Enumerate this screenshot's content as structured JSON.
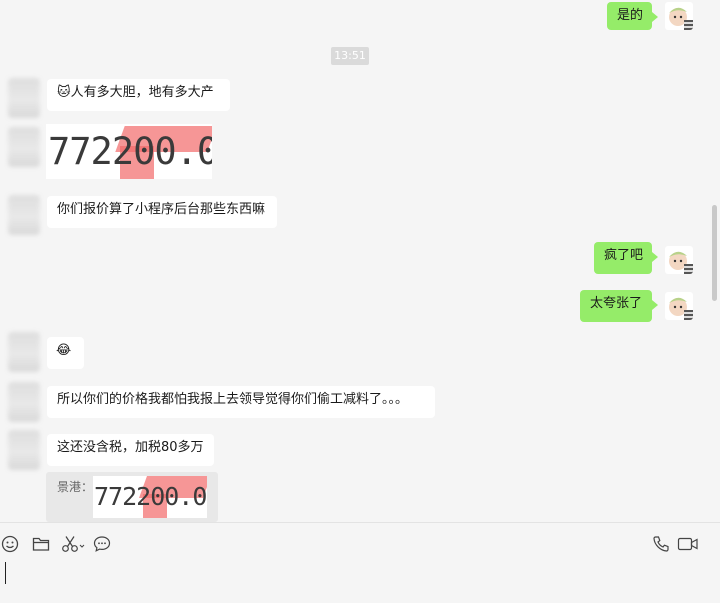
{
  "timestamp": "13:51",
  "messages": {
    "out_top": "是的",
    "in1_emoji": "🐱",
    "in1_text": "人有多大胆，地有多大产",
    "in2_text": "你们报价算了小程序后台那些东西嘛",
    "out2": "疯了吧",
    "out3": "太夸张了",
    "in3_emoji": "😂",
    "in4_text": "所以你们的价格我都怕我报上去领导觉得你们偷工减料了。。。",
    "in5_text": "这还没含税，加税80多万"
  },
  "image_message": {
    "value_text": "772200.0"
  },
  "quote": {
    "sender": "景港：",
    "value_text": "772200.0"
  },
  "toolbar": {
    "icons": [
      "emoji-icon",
      "folder-icon",
      "scissors-icon",
      "chat-bubble-icon",
      "phone-icon",
      "video-call-icon"
    ]
  },
  "colors": {
    "self_bubble": "#95ec69",
    "other_bubble": "#ffffff",
    "background": "#f5f5f5"
  }
}
